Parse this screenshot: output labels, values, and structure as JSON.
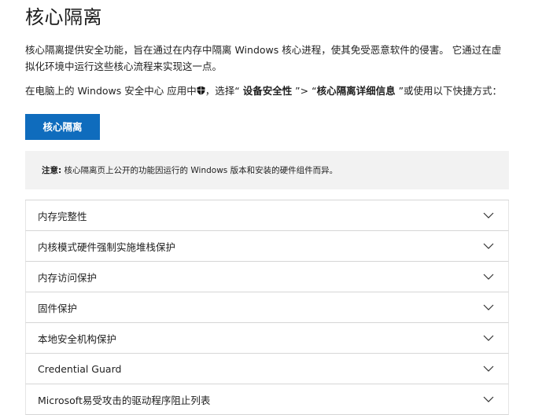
{
  "header": {
    "title": "核心隔离"
  },
  "intro": {
    "text_line1": "核心隔离提供安全功能，旨在通过在内存中隔离 Windows 核心进程，使其免受恶意软件的侵害。 它通过在虚",
    "text_line2": "拟化环境中运行这些核心流程来实现这一点。"
  },
  "path": {
    "prefix": "在电脑上的 Windows 安全中心 应用中",
    "mid": "，选择“ ",
    "section": "设备安全性",
    "sep": " ”> “",
    "details": "核心隔离详细信息",
    "suffix": " ”或使用以下快捷方式："
  },
  "shortcut_button": {
    "label": "核心隔离",
    "color": "#0f6cbd"
  },
  "note": {
    "label": "注意:",
    "text": " 核心隔离页上公开的功能因运行的 Windows 版本和安装的硬件组件而异。"
  },
  "accordion": {
    "items": [
      {
        "label": "内存完整性",
        "icon": "chevron-down-icon"
      },
      {
        "label": "内核模式硬件强制实施堆栈保护",
        "icon": "chevron-down-icon"
      },
      {
        "label": "内存访问保护",
        "icon": "chevron-down-icon"
      },
      {
        "label": "固件保护",
        "icon": "chevron-down-icon"
      },
      {
        "label": "本地安全机构保护",
        "icon": "chevron-down-icon"
      },
      {
        "label": "Credential Guard",
        "icon": "chevron-down-icon"
      },
      {
        "label": "Microsoft易受攻击的驱动程序阻止列表",
        "icon": "chevron-down-icon"
      }
    ]
  }
}
